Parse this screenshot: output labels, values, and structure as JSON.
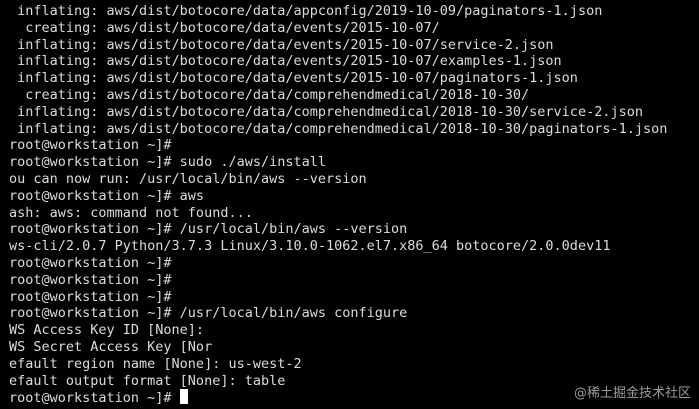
{
  "terminal": {
    "lines": [
      " inflating: aws/dist/botocore/data/appconfig/2019-10-09/paginators-1.json",
      "  creating: aws/dist/botocore/data/events/2015-10-07/",
      " inflating: aws/dist/botocore/data/events/2015-10-07/service-2.json",
      " inflating: aws/dist/botocore/data/events/2015-10-07/examples-1.json",
      " inflating: aws/dist/botocore/data/events/2015-10-07/paginators-1.json",
      "  creating: aws/dist/botocore/data/comprehendmedical/2018-10-30/",
      " inflating: aws/dist/botocore/data/comprehendmedical/2018-10-30/service-2.json",
      " inflating: aws/dist/botocore/data/comprehendmedical/2018-10-30/paginators-1.json",
      "root@workstation ~]#",
      "root@workstation ~]# sudo ./aws/install",
      "ou can now run: /usr/local/bin/aws --version",
      "root@workstation ~]# aws",
      "ash: aws: command not found...",
      "root@workstation ~]# /usr/local/bin/aws --version",
      "ws-cli/2.0.7 Python/3.7.3 Linux/3.10.0-1062.el7.x86_64 botocore/2.0.0dev11",
      "root@workstation ~]#",
      "root@workstation ~]#",
      "root@workstation ~]#",
      "root@workstation ~]# /usr/local/bin/aws configure",
      "WS Access Key ID [None]:",
      "WS Secret Access Key [Nor",
      "efault region name [None]: us-west-2",
      "efault output format [None]: table"
    ],
    "prompt": "root@workstation ~]# ",
    "watermark": "@稀土掘金技术社区"
  },
  "colors": {
    "background": "#000000",
    "foreground": "#dcdcdc",
    "cursor": "#ffffff"
  }
}
